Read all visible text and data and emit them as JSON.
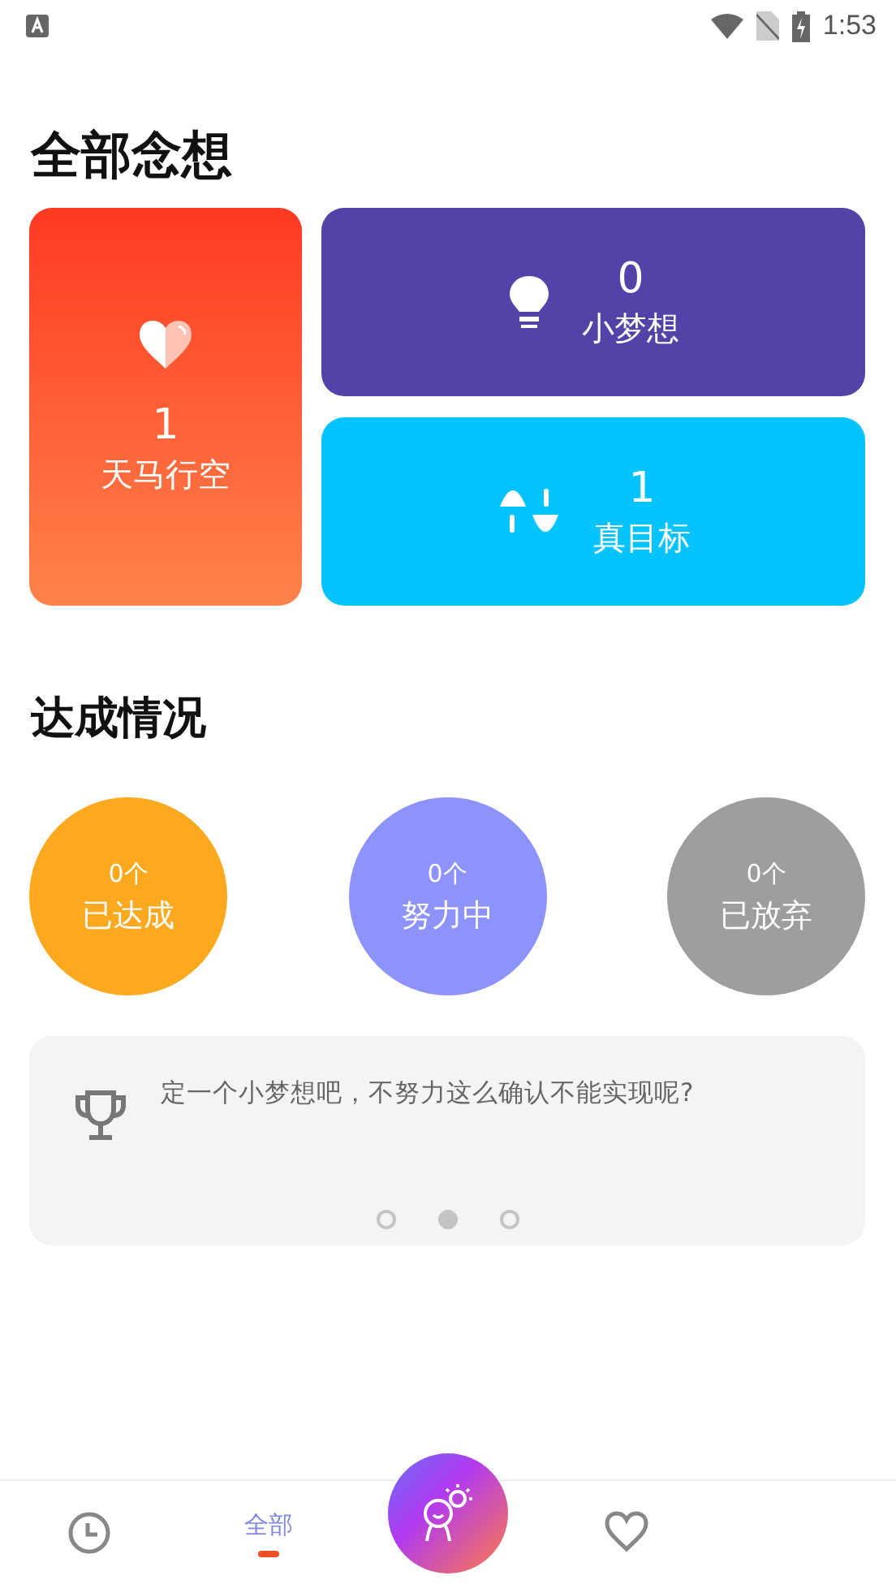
{
  "status_bar": {
    "time": "1:53"
  },
  "title": "全部念想",
  "categories": [
    {
      "kind": "dream_big",
      "count": "1",
      "label": "天马行空"
    },
    {
      "kind": "small_dream",
      "count": "0",
      "label": "小梦想"
    },
    {
      "kind": "real_goal",
      "count": "1",
      "label": "真目标"
    }
  ],
  "progress_title": "达成情况",
  "progress": [
    {
      "count": "0个",
      "label": "已达成",
      "color": "#fca91f"
    },
    {
      "count": "0个",
      "label": "努力中",
      "color": "#8c93fb"
    },
    {
      "count": "0个",
      "label": "已放弃",
      "color": "#9e9e9e"
    }
  ],
  "tip": {
    "text": "定一个小梦想吧，不努力这么确认不能实现呢?",
    "pages": [
      {
        "selected": false
      },
      {
        "selected": true
      },
      {
        "selected": false
      }
    ]
  },
  "bottom_nav": [
    {
      "kind": "clock",
      "selected": false
    },
    {
      "kind": "text",
      "label": "全部",
      "selected": true
    },
    {
      "kind": "add"
    },
    {
      "kind": "heart",
      "selected": false
    }
  ]
}
